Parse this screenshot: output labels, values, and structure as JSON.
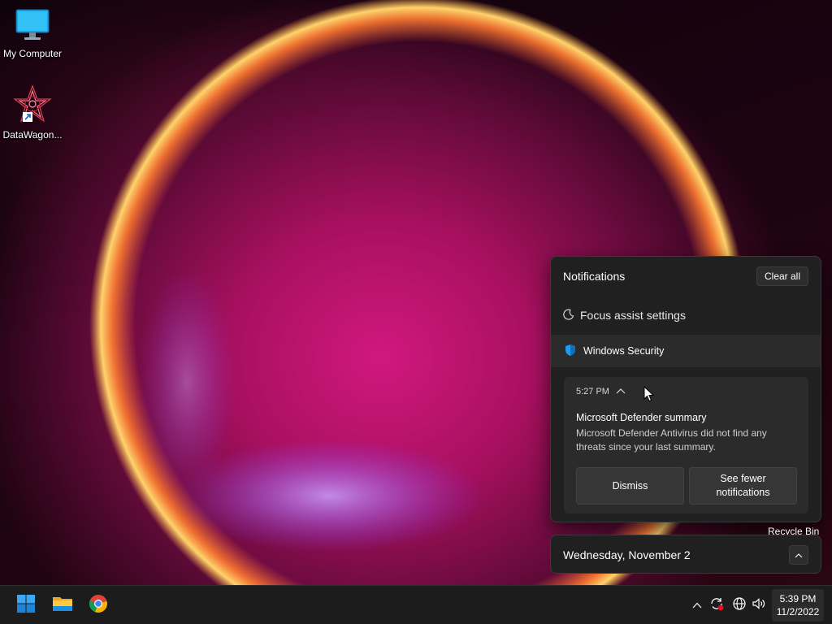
{
  "desktop": {
    "icons": [
      {
        "label": "My Computer",
        "icon": "monitor-icon"
      },
      {
        "label": "DataWagon...",
        "icon": "datawagon-shortcut-icon"
      }
    ],
    "recycle_bin_label": "Recycle Bin"
  },
  "notification_center": {
    "title": "Notifications",
    "clear_all_label": "Clear all",
    "focus_assist_label": "Focus assist settings",
    "app_name": "Windows Security",
    "notification": {
      "time": "5:27 PM",
      "title": "Microsoft Defender summary",
      "body": "Microsoft Defender Antivirus did not find any threats since your last summary.",
      "dismiss_label": "Dismiss",
      "see_fewer_label": "See fewer notifications"
    }
  },
  "calendar": {
    "date_label": "Wednesday, November 2"
  },
  "taskbar": {
    "pinned": [
      "start-icon",
      "file-explorer-icon",
      "chrome-icon"
    ],
    "tray": [
      "chevron-up-icon",
      "sync-icon",
      "globe-icon",
      "volume-icon"
    ],
    "clock_time": "5:39 PM",
    "clock_date": "11/2/2022"
  },
  "colors": {
    "panel_bg": "#202020",
    "card_bg": "#2b2b2b",
    "taskbar_bg": "#1c1c1c",
    "windows_blue": "#1d9bf0"
  }
}
